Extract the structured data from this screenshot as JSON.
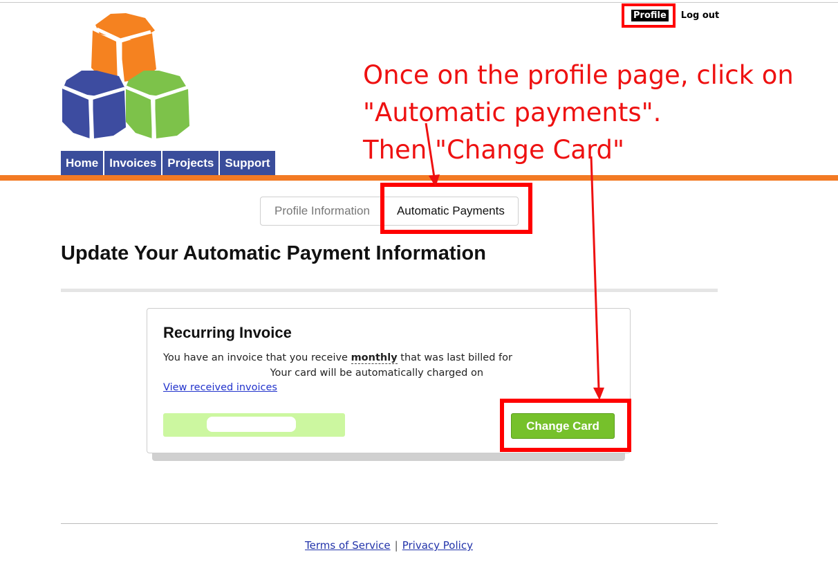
{
  "header": {
    "profile_label": "Profile",
    "logout_label": "Log out"
  },
  "nav": {
    "home": "Home",
    "invoices": "Invoices",
    "projects": "Projects",
    "support": "Support"
  },
  "tabs": {
    "profile_information": "Profile Information",
    "automatic_payments": "Automatic Payments"
  },
  "page_title": "Update Your Automatic Payment Information",
  "card": {
    "title": "Recurring Invoice",
    "text_part1": "You have an invoice that you receive ",
    "text_bold": "monthly",
    "text_part2": " that was last billed for",
    "text_part3": " Your card will be automatically charged on",
    "view_link": "View received invoices",
    "change_card_label": "Change Card"
  },
  "annotation": {
    "text": "Once on the profile page, click on\n\"Automatic payments\".\nThen \"Change Card\"",
    "color": "#ee1111"
  },
  "footer": {
    "terms": "Terms of Service",
    "separator": "|",
    "privacy": "Privacy Policy"
  },
  "colors": {
    "nav_blue": "#3a4d9b",
    "orange_bar": "#f37a24",
    "button_green": "#76c12b",
    "annotation_red": "#ff0000"
  }
}
